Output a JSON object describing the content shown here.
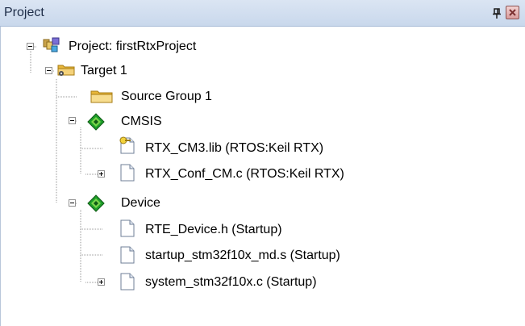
{
  "panel": {
    "title": "Project",
    "pin_icon": "pin-icon",
    "close_icon": "close-icon"
  },
  "tree": {
    "project": {
      "label": "Project: firstRtxProject",
      "icon": "project-icon",
      "expander": "minus"
    },
    "target": {
      "label": "Target 1",
      "icon": "target-folder-icon",
      "expander": "minus"
    },
    "source_group": {
      "label": "Source Group 1",
      "icon": "folder-icon"
    },
    "cmsis": {
      "label": "CMSIS",
      "icon": "component-icon",
      "expander": "minus"
    },
    "rtx_lib": {
      "label": "RTX_CM3.lib (RTOS:Keil RTX)",
      "icon": "library-file-icon"
    },
    "rtx_conf": {
      "label": "RTX_Conf_CM.c (RTOS:Keil RTX)",
      "icon": "file-icon",
      "expander": "plus"
    },
    "device": {
      "label": "Device",
      "icon": "component-icon",
      "expander": "minus"
    },
    "rte_device": {
      "label": "RTE_Device.h (Startup)",
      "icon": "file-icon"
    },
    "startup": {
      "label": "startup_stm32f10x_md.s (Startup)",
      "icon": "file-icon"
    },
    "system": {
      "label": "system_stm32f10x.c (Startup)",
      "icon": "file-icon",
      "expander": "plus"
    }
  }
}
